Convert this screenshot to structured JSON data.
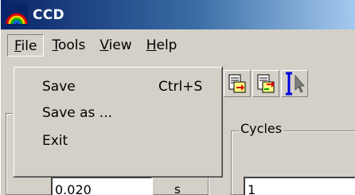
{
  "window": {
    "title": "CCD"
  },
  "menubar": {
    "items": [
      {
        "label": "File",
        "mnemonic": "F",
        "rest": "ile"
      },
      {
        "label": "Tools",
        "mnemonic": "T",
        "rest": "ools"
      },
      {
        "label": "View",
        "mnemonic": "V",
        "rest": "iew"
      },
      {
        "label": "Help",
        "mnemonic": "H",
        "rest": "elp"
      }
    ]
  },
  "file_menu": {
    "items": [
      {
        "label": "Save",
        "shortcut": "Ctrl+S"
      },
      {
        "label": "Save as ...",
        "shortcut": ""
      },
      {
        "label": "Exit",
        "shortcut": ""
      }
    ]
  },
  "exposure": {
    "value": "0.020",
    "unit": "s"
  },
  "cycles": {
    "label": "Cycles",
    "value": "1"
  },
  "toolbar": {
    "buttons": [
      {
        "icon": "export-document-icon"
      },
      {
        "icon": "import-document-icon"
      },
      {
        "icon": "text-cursor-icon"
      }
    ]
  },
  "colors": {
    "titlebar_start": "#0a246a",
    "titlebar_end": "#a6caf0",
    "face": "#d4d0c8"
  }
}
